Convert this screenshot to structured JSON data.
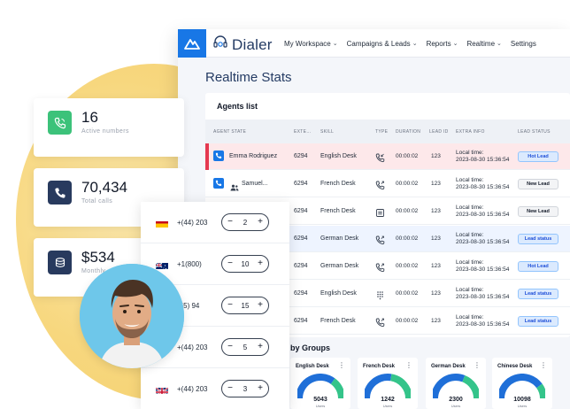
{
  "app": {
    "brand": "Dialer",
    "nav": [
      {
        "label": "My Workspace",
        "chevron": true
      },
      {
        "label": "Campaigns & Leads",
        "chevron": true
      },
      {
        "label": "Reports",
        "chevron": true
      },
      {
        "label": "Realtime",
        "chevron": true
      },
      {
        "label": "Settings",
        "chevron": false
      }
    ],
    "page_title": "Realtime Stats"
  },
  "agents": {
    "title": "Agents list",
    "columns": [
      "AGENT STATE",
      "EXTE…",
      "SKILL",
      "TYPE",
      "DURATION",
      "LEAD ID",
      "EXTRA INFO",
      "LEAD STATUS"
    ],
    "rows": [
      {
        "agent": "Emma Rodriguez",
        "ext": "6294",
        "skill": "English Desk",
        "type_icon": "phone-in-icon",
        "duration": "00:00:02",
        "lead_id": "123",
        "info_label": "Local time:",
        "info_time": "2023-08-30 15:36:54",
        "status": "Hot Lead",
        "state": "hot"
      },
      {
        "agent": "Samuel...",
        "ext": "6294",
        "skill": "French Desk",
        "type_icon": "phone-out-icon",
        "duration": "00:00:02",
        "lead_id": "123",
        "info_label": "Local time:",
        "info_time": "2023-08-30 15:36:54",
        "status": "New Lead",
        "state": "normal"
      },
      {
        "agent": "",
        "ext": "6294",
        "skill": "French Desk",
        "type_icon": "list-icon",
        "duration": "00:00:02",
        "lead_id": "123",
        "info_label": "Local time:",
        "info_time": "2023-08-30 15:36:54",
        "status": "New Lead",
        "state": "normal"
      },
      {
        "agent": "",
        "ext": "6294",
        "skill": "German Desk",
        "type_icon": "phone-out-icon",
        "duration": "00:00:02",
        "lead_id": "123",
        "info_label": "Local time:",
        "info_time": "2023-08-30 15:36:54",
        "status": "Lead status",
        "state": "selected"
      },
      {
        "agent": "",
        "ext": "6294",
        "skill": "German Desk",
        "type_icon": "phone-out-icon",
        "duration": "00:00:02",
        "lead_id": "123",
        "info_label": "Local time:",
        "info_time": "2023-08-30 15:36:54",
        "status": "Hot Lead",
        "state": "normal"
      },
      {
        "agent": "",
        "ext": "6294",
        "skill": "English Desk",
        "type_icon": "keypad-icon",
        "duration": "00:00:02",
        "lead_id": "123",
        "info_label": "Local time:",
        "info_time": "2023-08-30 15:36:54",
        "status": "Lead status",
        "state": "normal"
      },
      {
        "agent": "",
        "ext": "6294",
        "skill": "French Desk",
        "type_icon": "phone-out-icon",
        "duration": "00:00:02",
        "lead_id": "123",
        "info_label": "Local time:",
        "info_time": "2023-08-30 15:36:54",
        "status": "Lead status",
        "state": "normal"
      }
    ]
  },
  "groups": {
    "title": "by Groups",
    "cards": [
      {
        "name": "English Desk",
        "value": "5043",
        "label": "Users",
        "fill": 0.7
      },
      {
        "name": "French Desk",
        "value": "1242",
        "label": "Users",
        "fill": 0.55
      },
      {
        "name": "German Desk",
        "value": "2300",
        "label": "Users",
        "fill": 0.62
      },
      {
        "name": "Chinese Desk",
        "value": "10098",
        "label": "Users",
        "fill": 0.8
      }
    ]
  },
  "stats": [
    {
      "value": "16",
      "label": "Active numbers",
      "icon": "phone-active-icon",
      "color": "#3cc27a"
    },
    {
      "value": "70,434",
      "label": "Total calls",
      "icon": "phone-icon",
      "color": "#283a5e"
    },
    {
      "value": "$534",
      "label": "Monthly",
      "icon": "coins-icon",
      "color": "#283a5e"
    }
  ],
  "numbers": [
    {
      "flag": "spain-flag-icon",
      "prefix": "+(44) 203",
      "qty": "2"
    },
    {
      "flag": "australia-flag-icon",
      "prefix": "+1(800)",
      "qty": "10"
    },
    {
      "flag": "",
      "prefix": "(55) 94",
      "qty": "15"
    },
    {
      "flag": "",
      "prefix": "+(44) 203",
      "qty": "5"
    },
    {
      "flag": "uk-flag-icon",
      "prefix": "+(44) 203",
      "qty": "3"
    }
  ],
  "colors": {
    "primary": "#1877e6",
    "hot_row": "#fde8ea",
    "accent_red": "#e53950",
    "gauge_blue": "#1f6fd8",
    "gauge_green": "#34c48a",
    "blob": "#f7d77e"
  }
}
